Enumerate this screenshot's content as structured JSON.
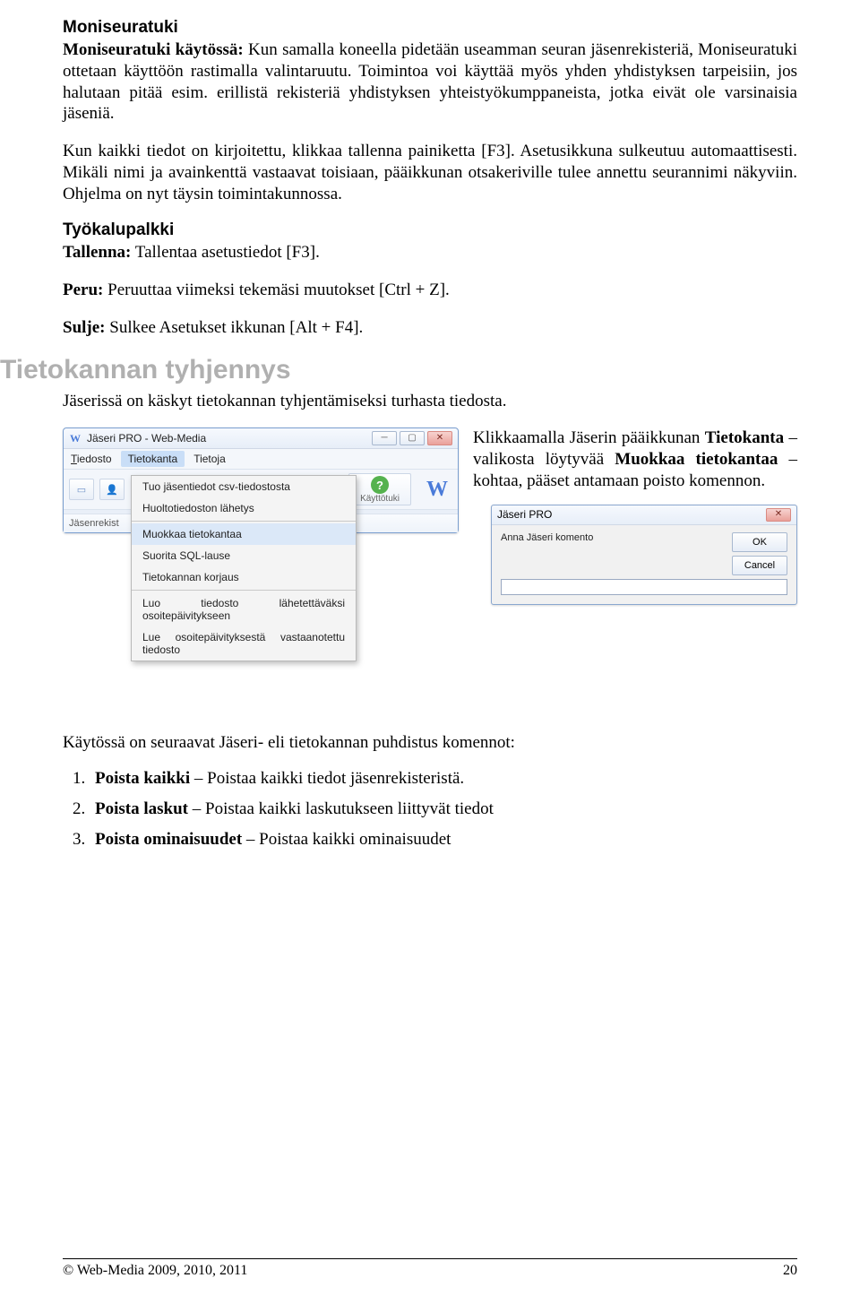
{
  "sec1": {
    "heading": "Moniseuratuki",
    "p1_label": "Moniseuratuki käytössä:",
    "p1_rest": " Kun samalla koneella pidetään useamman seuran jäsenrekisteriä, Moniseuratuki ottetaan käyttöön rastimalla valintaruutu. Toimintoa voi käyttää myös yhden yhdistyksen tarpeisiin, jos halutaan pitää esim. erillistä rekisteriä yhdistyksen yhteistyökumppaneista, jotka eivät ole varsinaisia jäseniä.",
    "p2": "Kun kaikki tiedot on kirjoitettu, klikkaa tallenna painiketta [F3]. Asetusikkuna sulkeutuu automaattisesti. Mikäli nimi ja avainkenttä vastaavat toisiaan, pääikkunan otsakeriville tulee annettu seurannimi näkyviin. Ohjelma on nyt täysin toimintakunnossa."
  },
  "sec2": {
    "heading": "Työkalupalkki",
    "tallenna_label": "Tallenna:",
    "tallenna_rest": " Tallentaa asetustiedot [F3].",
    "peru_label": "Peru:",
    "peru_rest": " Peruuttaa viimeksi tekemäsi muutokset  [Ctrl + Z].",
    "sulje_label": "Sulje:",
    "sulje_rest": " Sulkee Asetukset ikkunan [Alt + F4]."
  },
  "h2": "Tietokannan tyhjennys",
  "p_after_h2": "Jäserissä on käskyt tietokannan tyhjentämiseksi turhasta tiedosta.",
  "klikkaus": {
    "pre": "Klikkaamalla Jäserin pääikkunan ",
    "b1": "Tietokanta",
    "mid1": " – valikosta löytyvää ",
    "b2": "Muokkaa tietokantaa",
    "mid2": " – kohtaa, pääset antamaan poisto komennon."
  },
  "appwin": {
    "title": "Jäseri PRO - Web-Media",
    "menus": {
      "tiedosto": "Tiedosto",
      "tietokanta": "Tietokanta",
      "tietoja": "Tietoja"
    },
    "help_label": "Käyttötuki",
    "left_label": "Jäsenrekist",
    "dd": {
      "i1": "Tuo jäsentiedot csv-tiedostosta",
      "i2": "Huoltotiedoston lähetys",
      "i3": "Muokkaa tietokantaa",
      "i4": "Suorita SQL-lause",
      "i5": "Tietokannan korjaus",
      "i6": "Luo tiedosto lähetettäväksi osoitepäivitykseen",
      "i7": "Lue osoitepäivityksestä vastaanotettu tiedosto"
    }
  },
  "dialog": {
    "title": "Jäseri PRO",
    "prompt": "Anna Jäseri komento",
    "ok": "OK",
    "cancel": "Cancel"
  },
  "commands": {
    "intro": "Käytössä on seuraavat Jäseri- eli tietokannan puhdistus komennot:",
    "c1_b": "Poista kaikki",
    "c1_r": " – Poistaa kaikki tiedot jäsenrekisteristä.",
    "c2_b": "Poista laskut",
    "c2_r": " – Poistaa kaikki laskutukseen liittyvät tiedot",
    "c3_b": "Poista ominaisuudet",
    "c3_r": " – Poistaa kaikki ominaisuudet"
  },
  "footer": {
    "left": "© Web-Media 2009, 2010, 2011",
    "right": "20"
  },
  "glyphs": {
    "W": "W",
    "qmark": "?",
    "min": "─",
    "max": "▢",
    "close": "✕",
    "idcard": "▭",
    "user": "👤"
  }
}
